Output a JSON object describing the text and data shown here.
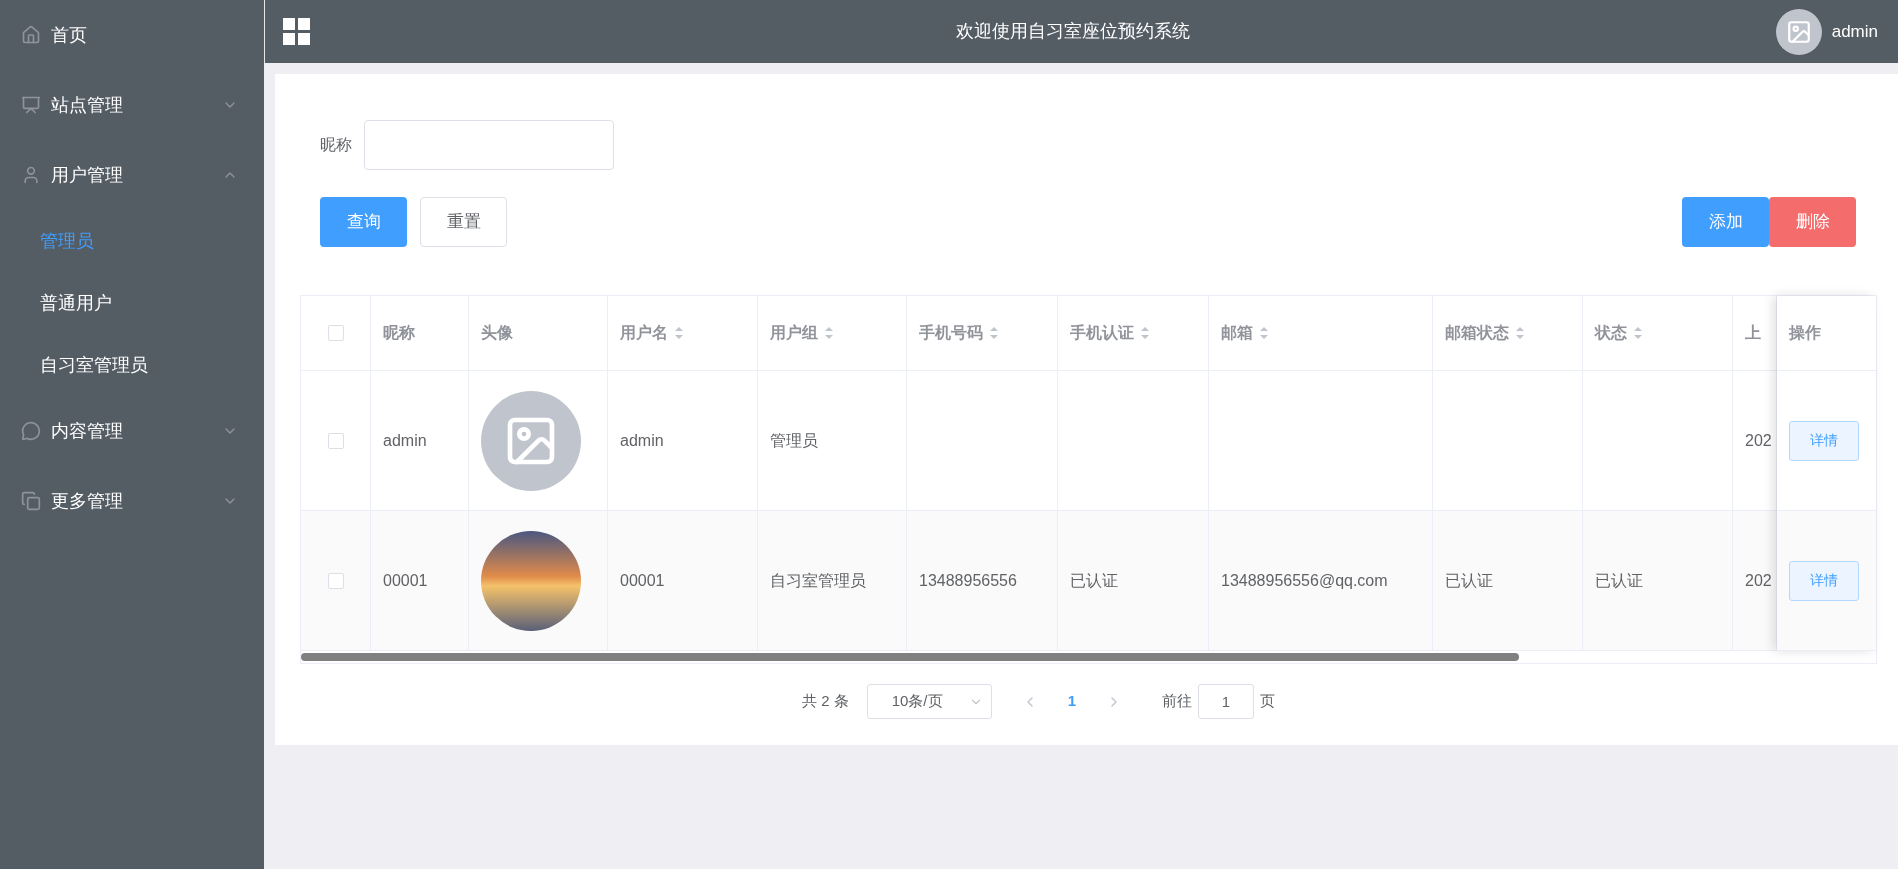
{
  "sidebar": {
    "items": [
      {
        "label": "首页"
      },
      {
        "label": "站点管理",
        "expanded": false
      },
      {
        "label": "用户管理",
        "expanded": true,
        "children": [
          {
            "label": "管理员",
            "selected": true
          },
          {
            "label": "普通用户",
            "selected": false
          },
          {
            "label": "自习室管理员",
            "selected": false
          }
        ]
      },
      {
        "label": "内容管理",
        "expanded": false
      },
      {
        "label": "更多管理",
        "expanded": false
      }
    ]
  },
  "header": {
    "title": "欢迎使用自习室座位预约系统",
    "user": "admin"
  },
  "search": {
    "label": "昵称",
    "query_button": "查询",
    "reset_button": "重置"
  },
  "actions": {
    "add_button": "添加",
    "delete_button": "删除"
  },
  "table": {
    "columns": [
      {
        "label": "昵称",
        "sortable": false
      },
      {
        "label": "头像",
        "sortable": false
      },
      {
        "label": "用户名",
        "sortable": true
      },
      {
        "label": "用户组",
        "sortable": true
      },
      {
        "label": "手机号码",
        "sortable": true
      },
      {
        "label": "手机认证",
        "sortable": true
      },
      {
        "label": "邮箱",
        "sortable": true
      },
      {
        "label": "邮箱状态",
        "sortable": true
      },
      {
        "label": "状态",
        "sortable": true
      },
      {
        "label": "上",
        "sortable": false
      }
    ],
    "action_column": "操作",
    "select_all_checked": false,
    "rows": [
      {
        "checked": false,
        "nickname": "admin",
        "avatar": {
          "kind": "placeholder"
        },
        "username": "admin",
        "group": "管理员",
        "last": "202",
        "action": "详情"
      },
      {
        "checked": false,
        "nickname": "00001",
        "avatar": {
          "kind": "photo"
        },
        "username": "00001",
        "group": "自习室管理员",
        "phone": "13488956556",
        "phone_verified": "已认证",
        "email": "13488956556@qq.com",
        "email_status": "已认证",
        "status": "已认证",
        "last": "202",
        "action": "详情"
      }
    ]
  },
  "pagination": {
    "total": "共 2 条",
    "page_size": "10条/页",
    "current_page": "1",
    "goto_label": "前往",
    "goto_value": "1",
    "page_unit": "页"
  }
}
